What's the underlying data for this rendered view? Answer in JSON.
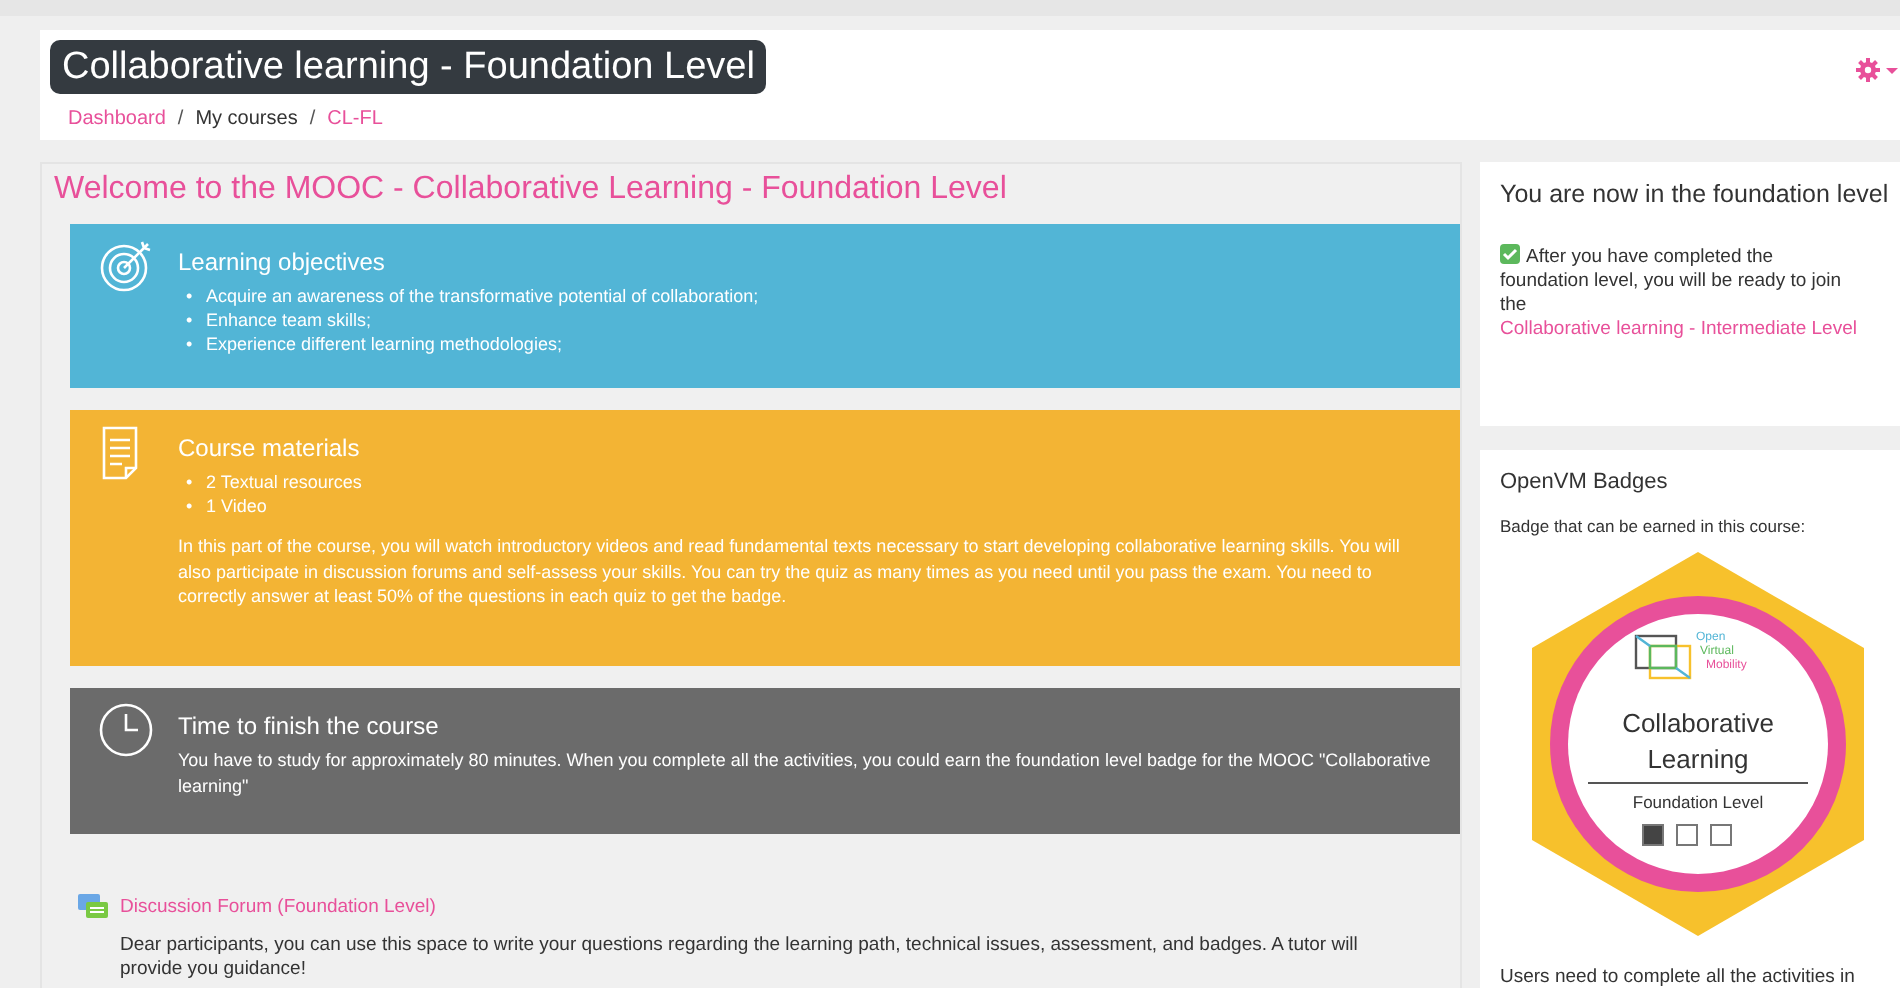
{
  "header": {
    "title": "Collaborative learning - Foundation Level",
    "breadcrumb": [
      {
        "label": "Dashboard",
        "link": true
      },
      {
        "separator": "/",
        "label": "My courses",
        "link": false
      },
      {
        "separator": "/",
        "label": "CL-FL",
        "link": true
      }
    ]
  },
  "main": {
    "heading": "Welcome to the MOOC - Collaborative Learning - Foundation Level",
    "blocks": [
      {
        "kind": "objectives",
        "title": "Learning objectives",
        "items": [
          {
            "bullet": "•",
            "text": "Acquire an awareness of the transformative potential of collaboration;"
          },
          {
            "bullet": "•",
            "text": "Enhance team skills;"
          },
          {
            "bullet": "•",
            "text": "Experience different learning methodologies;"
          }
        ]
      },
      {
        "kind": "materials",
        "title": "Course materials",
        "items": [
          {
            "bullet": "•",
            "text": "2 Textual resources"
          },
          {
            "bullet": "•",
            "text": "1 Video"
          }
        ],
        "text": "In this part of the course, you will watch introductory videos and read fundamental texts necessary to start developing collaborative learning skills. You will also participate in discussion forums and self-assess your skills. You can try the quiz as many times as you need until you pass the exam. You need to correctly answer at least 50% of the questions in each quiz to get the badge."
      },
      {
        "kind": "time",
        "title": "Time to finish the course",
        "text": "You have to study for approximately 80 minutes. When you complete all the activities, you could earn the foundation level badge for the MOOC \"Collaborative learning\""
      }
    ],
    "forum": {
      "title": "Discussion Forum (Foundation Level)",
      "text": "Dear participants, you can use this space to write your questions regarding the learning path, technical issues, assessment, and badges. A tutor will provide you guidance!"
    }
  },
  "sidebar": {
    "level_card": {
      "title": "You are now in the foundation level",
      "text": "After you have completed the foundation level, you will be ready to join the",
      "link": "Collaborative learning - Intermediate Level"
    },
    "badges_card": {
      "title": "OpenVM Badges",
      "intro": "Badge that can be earned in this course:",
      "badge": {
        "logo_lines": [
          "Open",
          "Virtual",
          "Mobility"
        ],
        "name": "Collaborative Learning",
        "level": "Foundation Level",
        "level_boxes": [
          {
            "filled": true
          },
          {
            "filled": false
          },
          {
            "filled": false
          }
        ]
      },
      "footer": "Users need to complete all the activities in"
    }
  }
}
